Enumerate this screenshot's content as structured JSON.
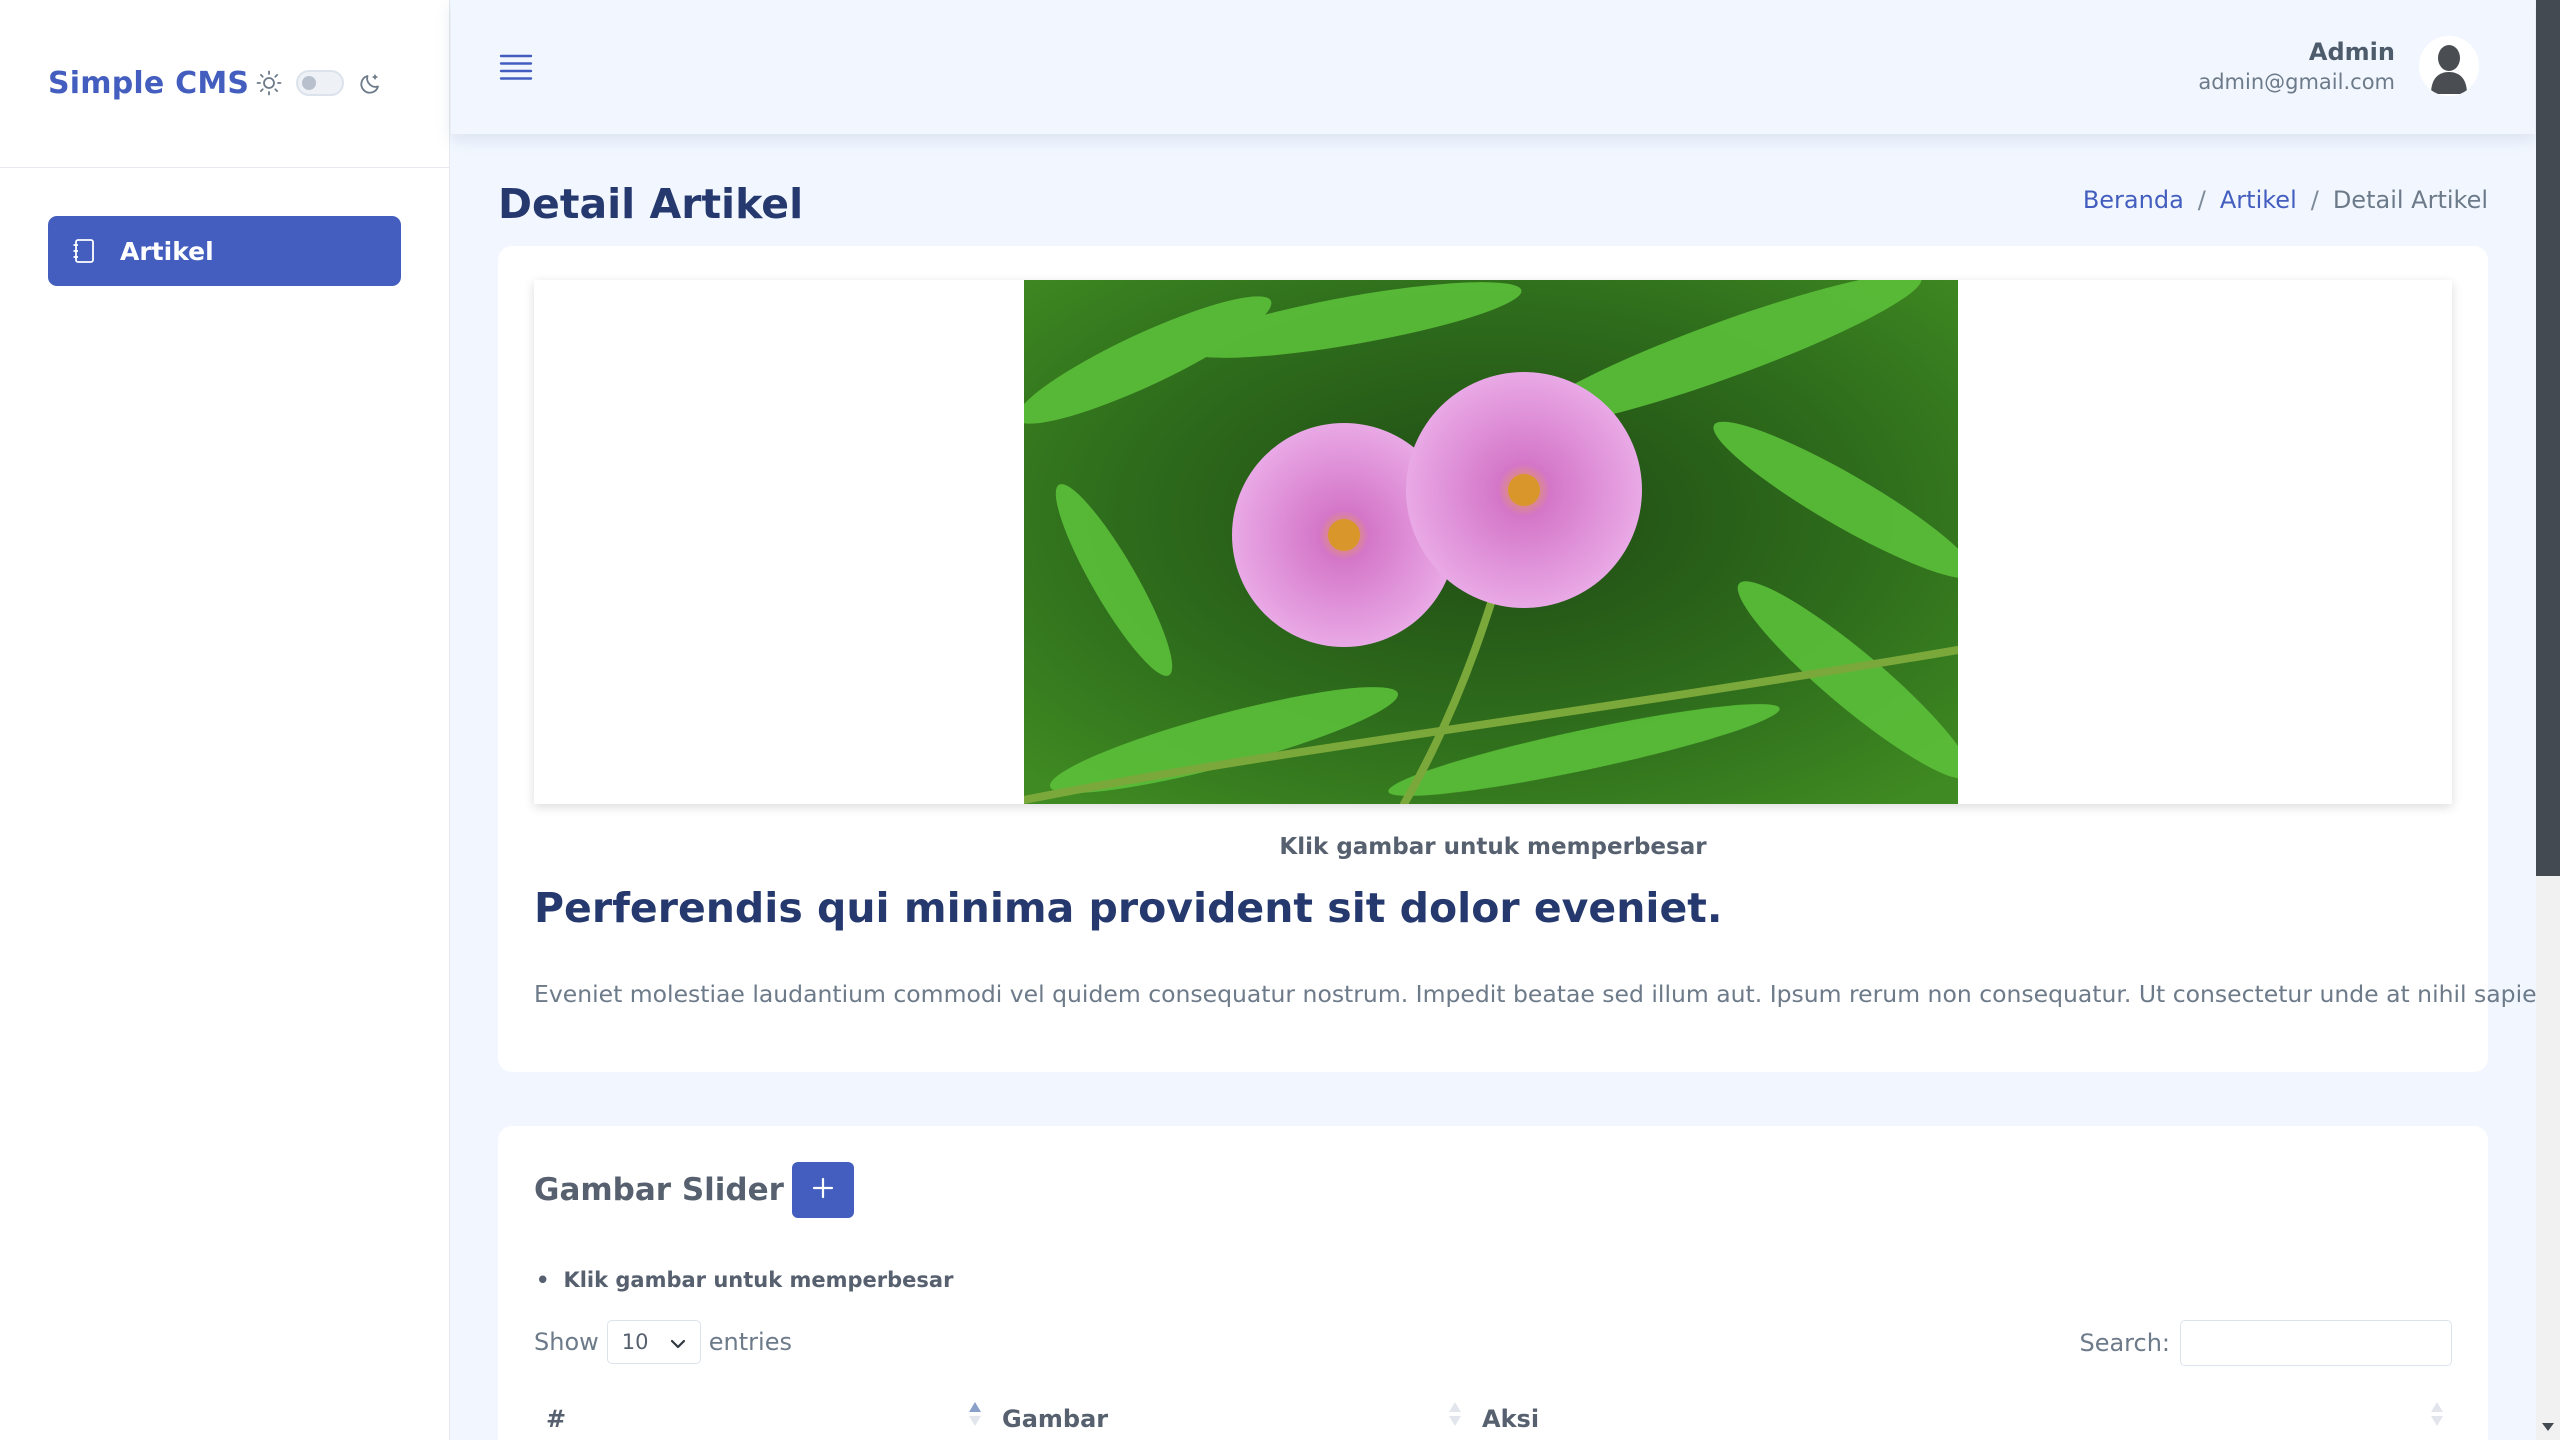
{
  "sidebar": {
    "brand": "Simple CMS",
    "items": [
      {
        "label": "Artikel",
        "icon": "journal-icon",
        "active": true
      }
    ]
  },
  "header": {
    "user": {
      "name": "Admin",
      "email": "admin@gmail.com"
    }
  },
  "page": {
    "title": "Detail Artikel",
    "breadcrumb": [
      {
        "label": "Beranda"
      },
      {
        "label": "Artikel"
      },
      {
        "label": "Detail Artikel"
      }
    ]
  },
  "article": {
    "image_caption": "Klik gambar untuk memperbesar",
    "title": "Perferendis qui minima provident sit dolor eveniet.",
    "body": "Eveniet molestiae laudantium commodi vel quidem consequatur nostrum. Impedit beatae sed illum aut. Ipsum rerum non consequatur. Ut consectetur unde at nihil sapiente officia."
  },
  "slider": {
    "title": "Gambar Slider",
    "add_label": "+",
    "notes": [
      "Klik gambar untuk memperbesar"
    ],
    "length": {
      "show": "Show",
      "value": "10",
      "entries": "entries"
    },
    "search_label": "Search:",
    "columns": [
      "#",
      "Gambar",
      "Aksi"
    ]
  },
  "colors": {
    "primary": "#435ebe",
    "heading": "#25396f",
    "background": "#f2f7ff"
  }
}
